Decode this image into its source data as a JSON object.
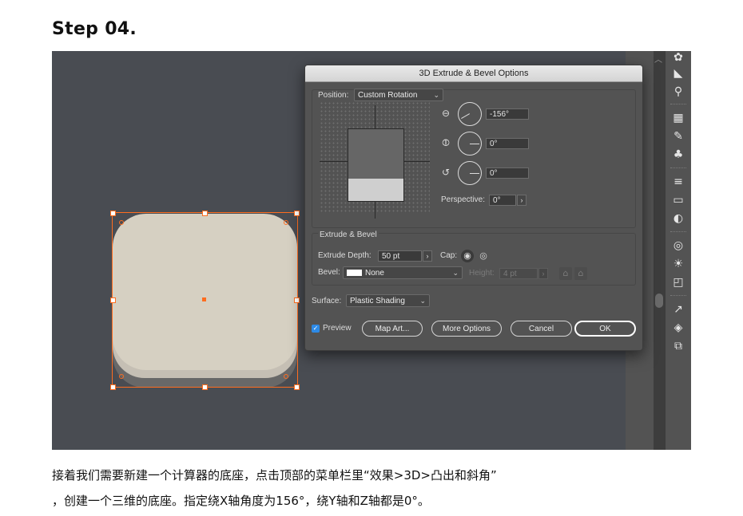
{
  "heading": "Step 04.",
  "dialog": {
    "title": "3D Extrude & Bevel Options",
    "position_label": "Position:",
    "position_value": "Custom Rotation",
    "rot_x": "-156°",
    "rot_y": "0°",
    "rot_z": "0°",
    "perspective_label": "Perspective:",
    "perspective_value": "0°",
    "extrude_section": "Extrude & Bevel",
    "extrude_depth_label": "Extrude Depth:",
    "extrude_depth_value": "50 pt",
    "cap_label": "Cap:",
    "bevel_label": "Bevel:",
    "bevel_value": "None",
    "height_label": "Height:",
    "height_value": "4 pt",
    "surface_label": "Surface:",
    "surface_value": "Plastic Shading",
    "preview_label": "Preview",
    "preview_checked": true,
    "buttons": {
      "map_art": "Map Art...",
      "more_options": "More Options",
      "cancel": "Cancel",
      "ok": "OK"
    }
  },
  "icons": {
    "x_axis": "x-axis-rotate-icon",
    "y_axis": "y-axis-rotate-icon",
    "z_axis": "z-axis-rotate-icon"
  },
  "selection_color": "#ff6d1f",
  "caption_line1": "接着我们需要新建一个计算器的底座，点击顶部的菜单栏里“效果>3D>凸出和斜角”",
  "caption_line2": "，创建一个三维的底座。指定绕X轴角度为156°，绕Y轴和Z轴都是0°。"
}
